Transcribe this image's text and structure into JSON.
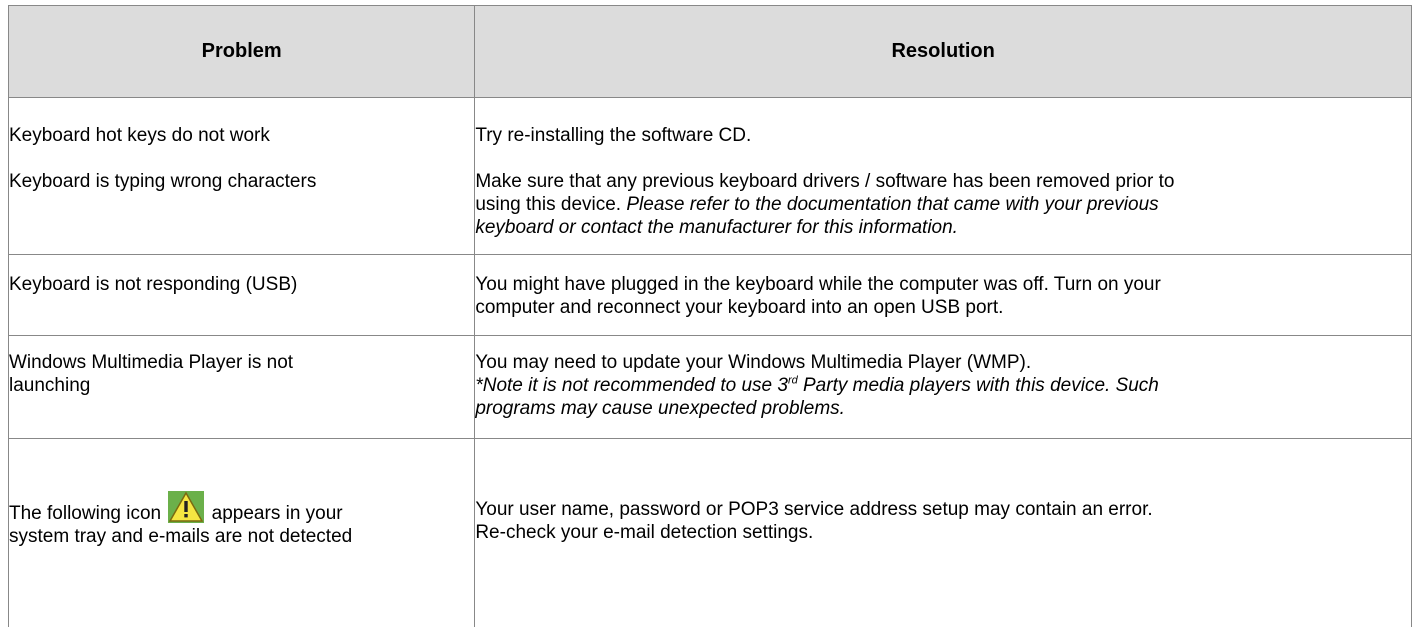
{
  "headers": {
    "problem": "Problem",
    "resolution": "Resolution"
  },
  "rows": [
    {
      "problems": [
        "Keyboard hot keys do not work",
        "Keyboard is typing wrong characters"
      ],
      "resolution_1": "Try re-installing the software CD.",
      "resolution_2_line1": "Make sure that any previous keyboard drivers / software has been removed prior to",
      "resolution_2_line2_plain": "using this device.",
      "resolution_2_line2_italic": " Please refer to the documentation that came with your previous",
      "resolution_2_line3_italic": "keyboard or contact the manufacturer for this information."
    },
    {
      "problem": "Keyboard is not responding (USB)",
      "resolution_line1": "You might have plugged in the keyboard while the computer was off. Turn on your",
      "resolution_line2": "computer and reconnect your keyboard into an open USB port."
    },
    {
      "problem_line1": "Windows Multimedia Player is not",
      "problem_line2": "launching",
      "resolution_line1": "You may need to update your Windows Multimedia Player (WMP).",
      "note_prefix": "*Note it is not recommended to use 3",
      "note_sup": "rd",
      "note_suffix": " Party media players with this device. Such",
      "note_line2": "programs may cause unexpected problems."
    },
    {
      "problem_before_icon": "The following icon",
      "icon": "warning-icon",
      "problem_after_icon": "appears in your",
      "problem_line2": "system tray and e-mails are not detected",
      "resolution_line1": "Your user name, password or POP3 service address setup may contain an error.",
      "resolution_line2": "Re-check your e-mail detection settings."
    }
  ],
  "colors": {
    "header_bg": "#dcdcdc",
    "border": "#888888",
    "warning_fill": "#f5e642",
    "warning_bg": "#6bb04a"
  }
}
